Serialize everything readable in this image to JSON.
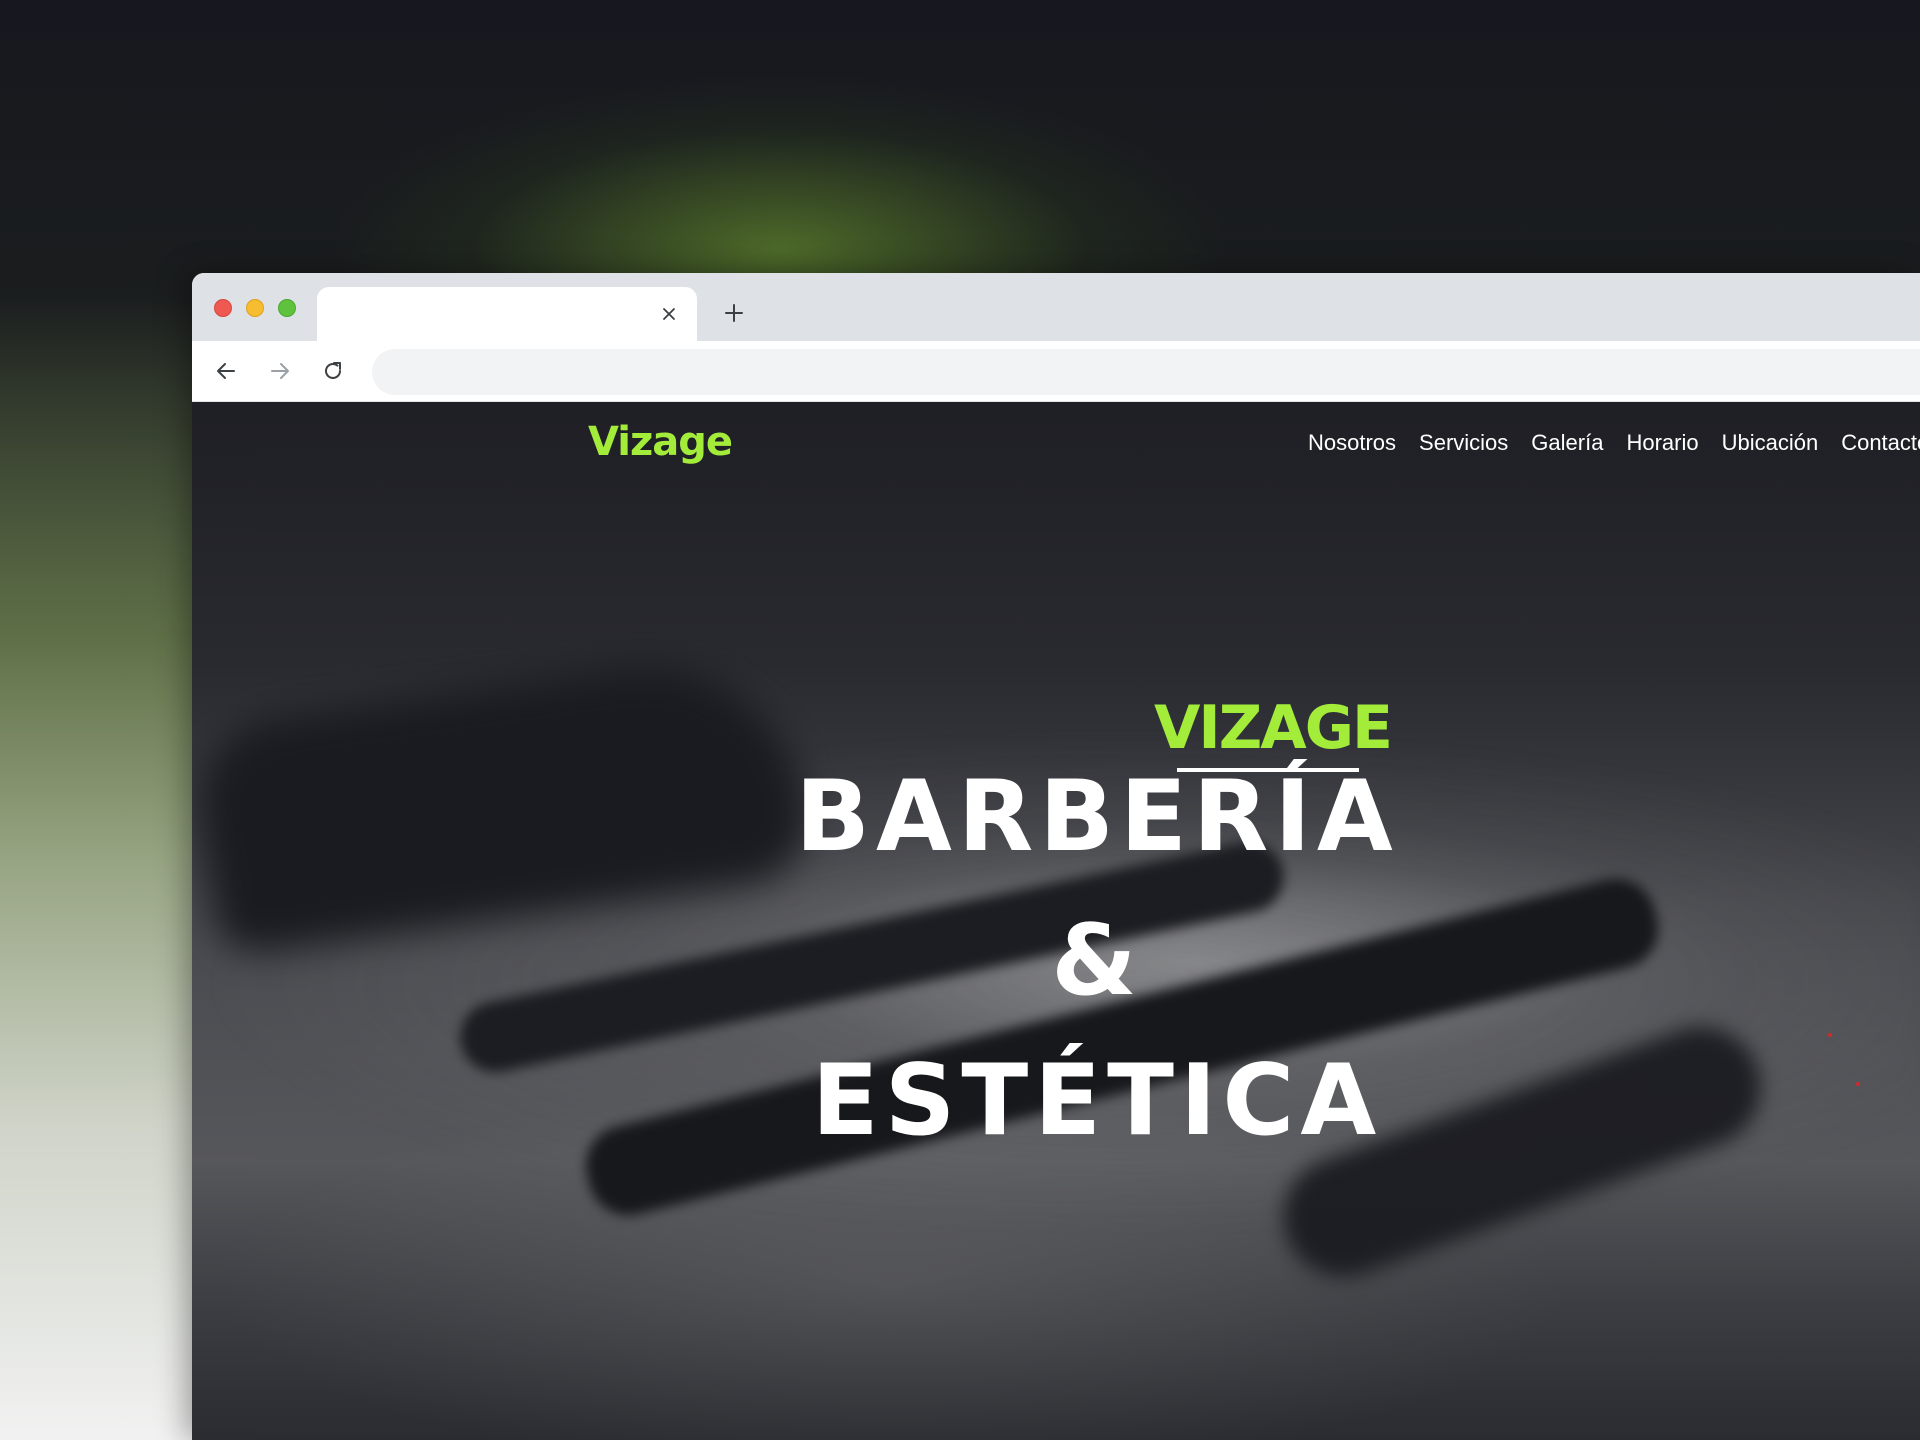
{
  "browser": {
    "tab_title": "",
    "address": "",
    "icons": {
      "tab_close": "close-icon",
      "new_tab": "plus-icon",
      "back": "arrow-left-icon",
      "forward": "arrow-right-icon",
      "reload": "reload-icon"
    },
    "traffic_light_colors": {
      "close": "#ee5a52",
      "minimize": "#f5bd2f",
      "maximize": "#5fc23e"
    }
  },
  "site": {
    "logo": "Vizage",
    "nav": [
      "Nosotros",
      "Servicios",
      "Galería",
      "Horario",
      "Ubicación",
      "Contacto"
    ],
    "hero": {
      "kicker": "VIZAGE",
      "line1": "BARBERÍA",
      "line2": "&",
      "line3": "ESTÉTICA"
    },
    "colors": {
      "accent": "#a3ec3a",
      "text": "#ffffff"
    }
  }
}
